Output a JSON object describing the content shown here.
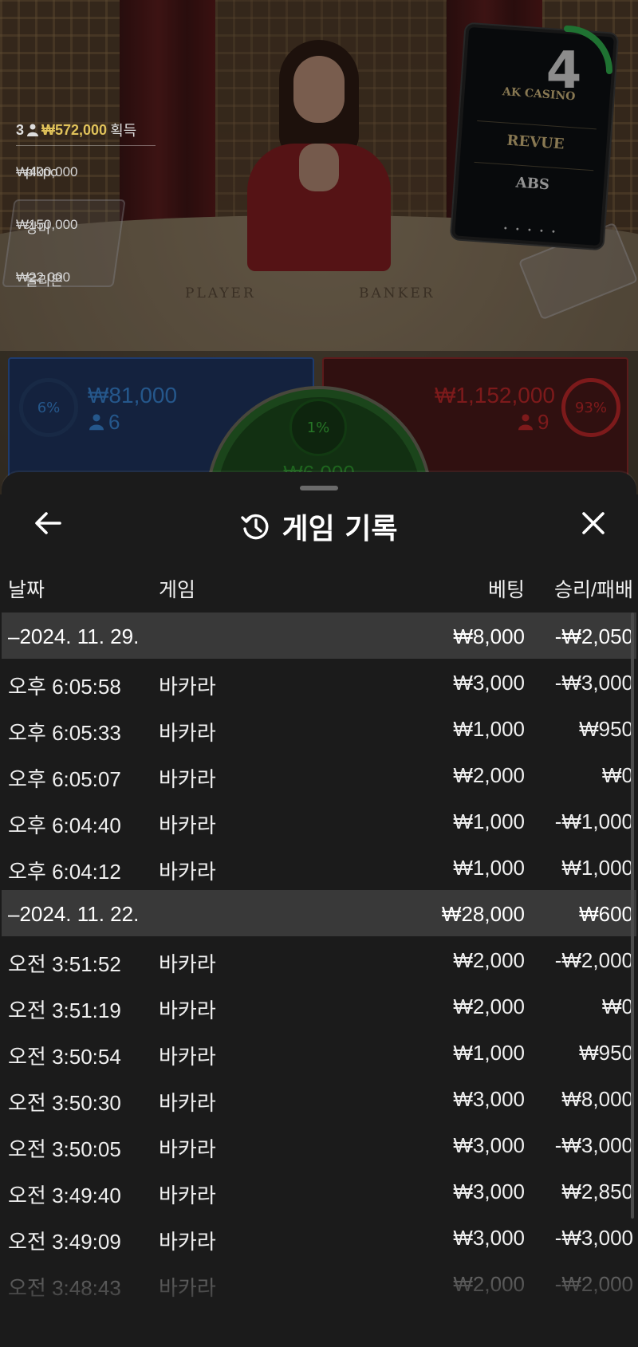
{
  "stream": {
    "felt_player_label": "PLAYER",
    "felt_banker_label": "BANKER",
    "board_brands": [
      "AK CASINO",
      "REVUE",
      "ABS"
    ],
    "countdown": "4",
    "winners": {
      "count": "3",
      "total": "₩572,000",
      "suffix": "획득",
      "list": [
        {
          "amount": "₩400,000",
          "name": "plkpo"
        },
        {
          "amount": "₩150,000",
          "name": "강미"
        },
        {
          "amount": "₩22,000",
          "name": "올리온"
        }
      ]
    }
  },
  "bets": {
    "player": {
      "percent": "6%",
      "amount": "₩81,000",
      "players": "6",
      "color": "#2f7fd0"
    },
    "tie": {
      "percent": "1%",
      "amount": "₩6,000",
      "color": "#2f9a2f"
    },
    "banker": {
      "percent": "93%",
      "amount": "₩1,152,000",
      "players": "9",
      "color": "#c0282a"
    }
  },
  "history": {
    "title": "게임 기록",
    "back_icon": "arrow-left-icon",
    "close_icon": "close-icon",
    "title_icon": "history-clock-icon",
    "columns": {
      "date": "날짜",
      "game": "게임",
      "bet": "베팅",
      "win_loss": "승리/패배"
    },
    "groups": [
      {
        "date": "–2024. 11. 29.",
        "bet_total": "₩8,000",
        "result_total": "-₩2,050",
        "rows": [
          {
            "time": "오후 6:05:58",
            "game": "바카라",
            "bet": "₩3,000",
            "result": "-₩3,000"
          },
          {
            "time": "오후 6:05:33",
            "game": "바카라",
            "bet": "₩1,000",
            "result": "₩950"
          },
          {
            "time": "오후 6:05:07",
            "game": "바카라",
            "bet": "₩2,000",
            "result": "₩0"
          },
          {
            "time": "오후 6:04:40",
            "game": "바카라",
            "bet": "₩1,000",
            "result": "-₩1,000"
          },
          {
            "time": "오후 6:04:12",
            "game": "바카라",
            "bet": "₩1,000",
            "result": "₩1,000"
          }
        ]
      },
      {
        "date": "–2024. 11. 22.",
        "bet_total": "₩28,000",
        "result_total": "₩600",
        "rows": [
          {
            "time": "오전 3:51:52",
            "game": "바카라",
            "bet": "₩2,000",
            "result": "-₩2,000"
          },
          {
            "time": "오전 3:51:19",
            "game": "바카라",
            "bet": "₩2,000",
            "result": "₩0"
          },
          {
            "time": "오전 3:50:54",
            "game": "바카라",
            "bet": "₩1,000",
            "result": "₩950"
          },
          {
            "time": "오전 3:50:30",
            "game": "바카라",
            "bet": "₩3,000",
            "result": "₩8,000"
          },
          {
            "time": "오전 3:50:05",
            "game": "바카라",
            "bet": "₩3,000",
            "result": "-₩3,000"
          },
          {
            "time": "오전 3:49:40",
            "game": "바카라",
            "bet": "₩3,000",
            "result": "₩2,850"
          },
          {
            "time": "오전 3:49:09",
            "game": "바카라",
            "bet": "₩3,000",
            "result": "-₩3,000"
          },
          {
            "time": "오전 3:48:43",
            "game": "바카라",
            "bet": "₩2,000",
            "result": "-₩2,000"
          }
        ]
      }
    ]
  }
}
